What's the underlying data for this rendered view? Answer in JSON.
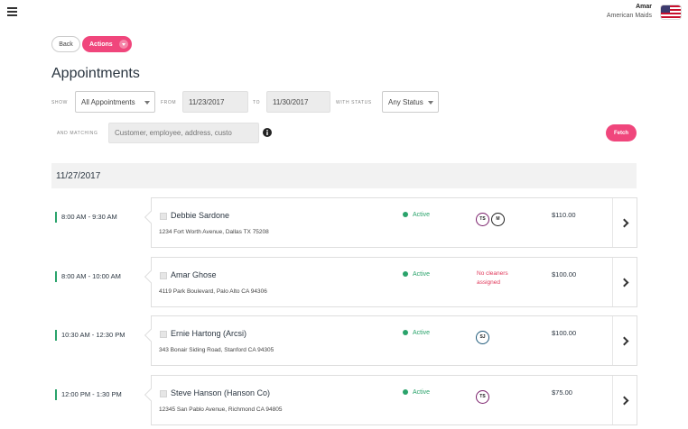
{
  "user": {
    "name": "Amar",
    "company": "American Maids"
  },
  "toolbar": {
    "back_label": "Back",
    "actions_label": "Actions"
  },
  "page": {
    "title": "Appointments"
  },
  "filters": {
    "show_label": "SHOW",
    "show_value": "All Appointments",
    "from_label": "FROM",
    "from_value": "11/23/2017",
    "to_label": "TO",
    "to_value": "11/30/2017",
    "status_label": "WITH STATUS",
    "status_value": "Any Status",
    "matching_label": "AND MATCHING",
    "search_placeholder": "Customer, employee, address, custo",
    "fetch_label": "Fetch"
  },
  "date_group": "11/27/2017",
  "appointments": [
    {
      "time": "8:00 AM - 9:30 AM",
      "name": "Debbie Sardone",
      "address": "1234 Fort Worth Avenue, Dallas TX 75208",
      "status": "Active",
      "cleaners": [
        "TS",
        "M"
      ],
      "cleaner_colors": [
        "#7a1f6b",
        "#222222"
      ],
      "price": "$110.00"
    },
    {
      "time": "8:00 AM - 10:00 AM",
      "name": "Amar Ghose",
      "address": "4119 Park Boulevard, Palo Alto CA 94306",
      "status": "Active",
      "no_cleaners": "No cleaners assigned",
      "price": "$100.00"
    },
    {
      "time": "10:30 AM - 12:30 PM",
      "name": "Ernie Hartong (Arcsi)",
      "address": "343 Bonair Siding Road, Stanford CA 94305",
      "status": "Active",
      "cleaners": [
        "SJ"
      ],
      "cleaner_colors": [
        "#1f5a7a"
      ],
      "price": "$100.00"
    },
    {
      "time": "12:00 PM - 1:30 PM",
      "name": "Steve Hanson (Hanson Co)",
      "address": "12345 San Pablo Avenue, Richmond CA 94805",
      "status": "Active",
      "cleaners": [
        "TS"
      ],
      "cleaner_colors": [
        "#7a1f6b"
      ],
      "price": "$75.00"
    }
  ],
  "colors": {
    "accent": "#f0467c",
    "active": "#2aa36b",
    "warning": "#e0395b"
  }
}
